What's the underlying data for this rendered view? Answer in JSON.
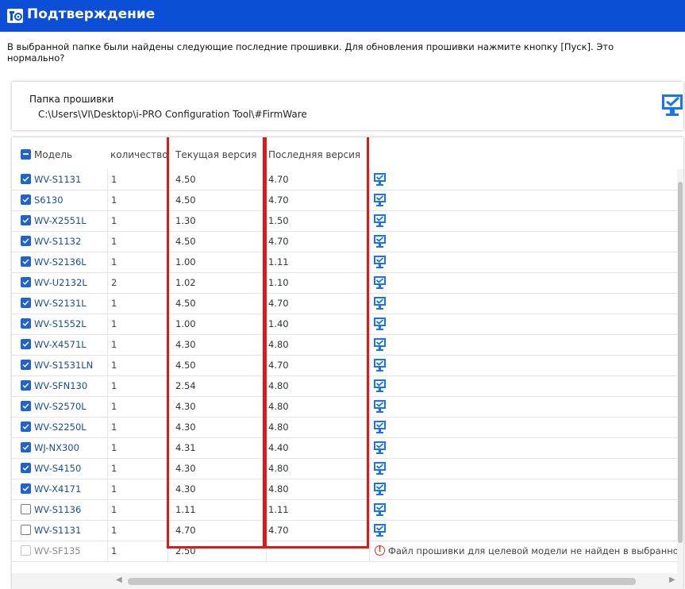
{
  "window": {
    "title": "Подтверждение",
    "accent": "#0a4fd6"
  },
  "message": "В выбранной папке были найдены следующие последние прошивки. Для обновления прошивки нажмите кнопку [Пуск]. Это нормально?",
  "folder": {
    "label": "Папка прошивки",
    "path": "C:\\Users\\VI\\Desktop\\i-PRO Configuration Tool\\#FirmWare"
  },
  "table": {
    "columns": {
      "model": "Модель",
      "quantity": "количество",
      "current": "Текущая версия",
      "latest": "Последняя версия"
    },
    "rows": [
      {
        "model": "WV-S1131",
        "qty": "1",
        "current": "4.50",
        "latest": "4.70",
        "checked": true,
        "status": "ok"
      },
      {
        "model": "S6130",
        "qty": "1",
        "current": "4.50",
        "latest": "4.70",
        "checked": true,
        "status": "ok"
      },
      {
        "model": "WV-X2551L",
        "qty": "1",
        "current": "1.30",
        "latest": "1.50",
        "checked": true,
        "status": "ok"
      },
      {
        "model": "WV-S1132",
        "qty": "1",
        "current": "4.50",
        "latest": "4.70",
        "checked": true,
        "status": "ok"
      },
      {
        "model": "WV-S2136L",
        "qty": "1",
        "current": "1.00",
        "latest": "1.11",
        "checked": true,
        "status": "ok"
      },
      {
        "model": "WV-U2132L",
        "qty": "2",
        "current": "1.02",
        "latest": "1.10",
        "checked": true,
        "status": "ok"
      },
      {
        "model": "WV-S2131L",
        "qty": "1",
        "current": "4.50",
        "latest": "4.70",
        "checked": true,
        "status": "ok"
      },
      {
        "model": "WV-S1552L",
        "qty": "1",
        "current": "1.00",
        "latest": "1.40",
        "checked": true,
        "status": "ok"
      },
      {
        "model": "WV-X4571L",
        "qty": "1",
        "current": "4.30",
        "latest": "4.80",
        "checked": true,
        "status": "ok"
      },
      {
        "model": "WV-S1531LN",
        "qty": "1",
        "current": "4.50",
        "latest": "4.70",
        "checked": true,
        "status": "ok"
      },
      {
        "model": "WV-SFN130",
        "qty": "1",
        "current": "2.54",
        "latest": "4.80",
        "checked": true,
        "status": "ok"
      },
      {
        "model": "WV-S2570L",
        "qty": "1",
        "current": "4.30",
        "latest": "4.80",
        "checked": true,
        "status": "ok"
      },
      {
        "model": "WV-S2250L",
        "qty": "1",
        "current": "4.30",
        "latest": "4.80",
        "checked": true,
        "status": "ok"
      },
      {
        "model": "WJ-NX300",
        "qty": "1",
        "current": "4.31",
        "latest": "4.40",
        "checked": true,
        "status": "ok"
      },
      {
        "model": "WV-S4150",
        "qty": "1",
        "current": "4.30",
        "latest": "4.80",
        "checked": true,
        "status": "ok"
      },
      {
        "model": "WV-X4171",
        "qty": "1",
        "current": "4.30",
        "latest": "4.80",
        "checked": true,
        "status": "ok"
      },
      {
        "model": "WV-S1136",
        "qty": "1",
        "current": "1.11",
        "latest": "1.11",
        "checked": false,
        "status": "ok"
      },
      {
        "model": "WV-S1131",
        "qty": "1",
        "current": "4.70",
        "latest": "4.70",
        "checked": false,
        "status": "ok"
      },
      {
        "model": "WV-SF135",
        "qty": "1",
        "current": "2.50",
        "latest": "",
        "checked": false,
        "disabled": true,
        "status": "error",
        "status_text": "Файл прошивки для целевой модели не найден в выбранной"
      }
    ]
  },
  "icons": {
    "app": "settings-tool-icon",
    "folder_status": "monitor-check-icon",
    "row_ok": "monitor-check-icon",
    "row_error": "warning-circle-icon"
  },
  "highlight_color": "#e01818"
}
